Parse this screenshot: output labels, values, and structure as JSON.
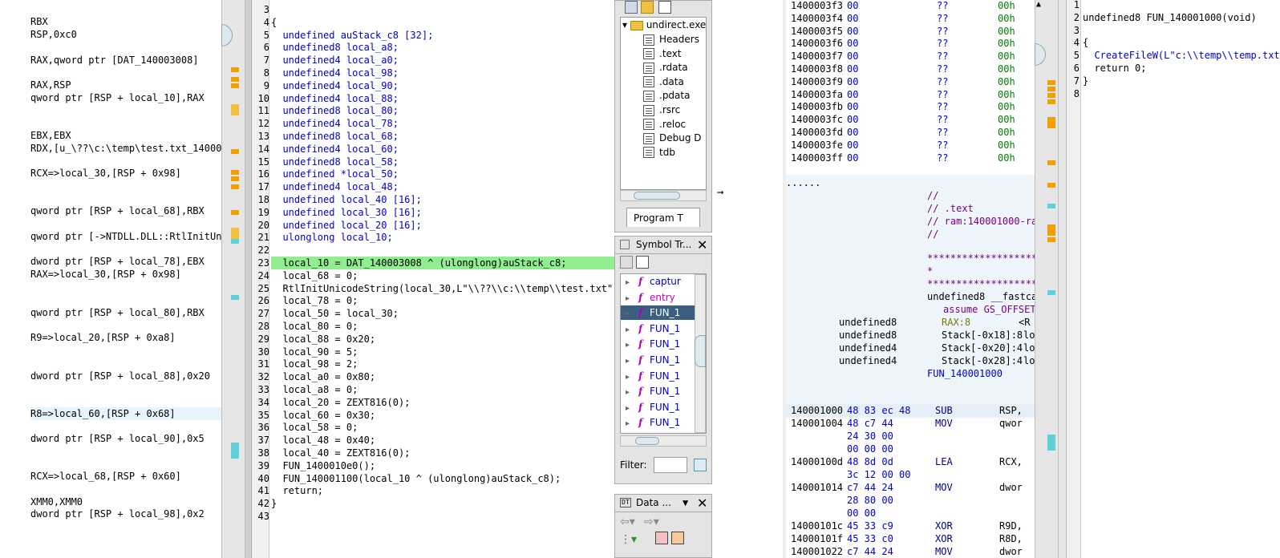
{
  "listing_left": {
    "lines": [
      {
        "t": "RBX",
        "c": ""
      },
      {
        "t": "RSP,0xc0",
        "c": ""
      },
      {
        "t": "",
        "c": ""
      },
      {
        "t": "RAX,qword ptr [DAT_140003008]",
        "c": ""
      },
      {
        "t": "",
        "c": ""
      },
      {
        "t": "RAX,RSP",
        "c": ""
      },
      {
        "t": "qword ptr [RSP + local_10],RAX",
        "c": ""
      },
      {
        "t": "",
        "c": ""
      },
      {
        "t": "",
        "c": ""
      },
      {
        "t": "EBX,EBX",
        "c": ""
      },
      {
        "t": "RDX,[u_\\??\\c:\\temp\\test.txt_140002",
        "c": ""
      },
      {
        "t": "",
        "c": ""
      },
      {
        "t": "RCX=>local_30,[RSP + 0x98]",
        "c": ""
      },
      {
        "t": "",
        "c": ""
      },
      {
        "t": "",
        "c": ""
      },
      {
        "t": "qword ptr [RSP + local_68],RBX",
        "c": ""
      },
      {
        "t": "",
        "c": ""
      },
      {
        "t": "qword ptr [->NTDLL.DLL::RtlInitUni",
        "c": ""
      },
      {
        "t": "",
        "c": ""
      },
      {
        "t": "dword ptr [RSP + local_78],EBX",
        "c": ""
      },
      {
        "t": "RAX=>local_30,[RSP + 0x98]",
        "c": ""
      },
      {
        "t": "",
        "c": ""
      },
      {
        "t": "",
        "c": ""
      },
      {
        "t": "qword ptr [RSP + local_80],RBX",
        "c": ""
      },
      {
        "t": "",
        "c": ""
      },
      {
        "t": "R9=>local_20,[RSP + 0xa8]",
        "c": ""
      },
      {
        "t": "",
        "c": ""
      },
      {
        "t": "",
        "c": ""
      },
      {
        "t": "dword ptr [RSP + local_88],0x20",
        "c": ""
      },
      {
        "t": "",
        "c": ""
      },
      {
        "t": "",
        "c": ""
      },
      {
        "t": "R8=>local_60,[RSP + 0x68]",
        "c": "sel"
      },
      {
        "t": "",
        "c": ""
      },
      {
        "t": "dword ptr [RSP + local_90],0x5",
        "c": ""
      },
      {
        "t": "",
        "c": ""
      },
      {
        "t": "",
        "c": ""
      },
      {
        "t": "RCX=>local_68,[RSP + 0x60]",
        "c": ""
      },
      {
        "t": "",
        "c": ""
      },
      {
        "t": "XMM0,XMM0",
        "c": ""
      },
      {
        "t": "dword ptr [RSP + local_98],0x2",
        "c": ""
      }
    ]
  },
  "decompile_main": {
    "lines": [
      {
        "n": "3",
        "t": ""
      },
      {
        "n": "4",
        "t": "{"
      },
      {
        "n": "5",
        "t": "  undefined auStack_c8 [32];"
      },
      {
        "n": "6",
        "t": "  undefined8 local_a8;"
      },
      {
        "n": "7",
        "t": "  undefined4 local_a0;"
      },
      {
        "n": "8",
        "t": "  undefined4 local_98;"
      },
      {
        "n": "9",
        "t": "  undefined4 local_90;"
      },
      {
        "n": "10",
        "t": "  undefined4 local_88;"
      },
      {
        "n": "11",
        "t": "  undefined8 local_80;"
      },
      {
        "n": "12",
        "t": "  undefined4 local_78;"
      },
      {
        "n": "13",
        "t": "  undefined8 local_68;"
      },
      {
        "n": "14",
        "t": "  undefined4 local_60;"
      },
      {
        "n": "15",
        "t": "  undefined8 local_58;"
      },
      {
        "n": "16",
        "t": "  undefined *local_50;"
      },
      {
        "n": "17",
        "t": "  undefined4 local_48;"
      },
      {
        "n": "18",
        "t": "  undefined local_40 [16];"
      },
      {
        "n": "19",
        "t": "  undefined local_30 [16];"
      },
      {
        "n": "20",
        "t": "  undefined local_20 [16];"
      },
      {
        "n": "21",
        "t": "  ulonglong local_10;"
      },
      {
        "n": "22",
        "t": ""
      },
      {
        "n": "23",
        "t": "  local_10 = DAT_140003008 ^ (ulonglong)auStack_c8;"
      },
      {
        "n": "24",
        "t": "  local_68 = 0;"
      },
      {
        "n": "25",
        "t": "  RtlInitUnicodeString(local_30,L\"\\\\??\\\\c:\\\\temp\\\\test.txt\");"
      },
      {
        "n": "26",
        "t": "  local_78 = 0;"
      },
      {
        "n": "27",
        "t": "  local_50 = local_30;"
      },
      {
        "n": "28",
        "t": "  local_80 = 0;"
      },
      {
        "n": "29",
        "t": "  local_88 = 0x20;"
      },
      {
        "n": "30",
        "t": "  local_90 = 5;"
      },
      {
        "n": "31",
        "t": "  local_98 = 2;"
      },
      {
        "n": "32",
        "t": "  local_a0 = 0x80;"
      },
      {
        "n": "33",
        "t": "  local_a8 = 0;"
      },
      {
        "n": "34",
        "t": "  local_20 = ZEXT816(0);"
      },
      {
        "n": "35",
        "t": "  local_60 = 0x30;"
      },
      {
        "n": "36",
        "t": "  local_58 = 0;"
      },
      {
        "n": "37",
        "t": "  local_48 = 0x40;"
      },
      {
        "n": "38",
        "t": "  local_40 = ZEXT816(0);"
      },
      {
        "n": "39",
        "t": "  FUN_1400010e0();"
      },
      {
        "n": "40",
        "t": "  FUN_140001100(local_10 ^ (ulonglong)auStack_c8);"
      },
      {
        "n": "41",
        "t": "  return;"
      },
      {
        "n": "42",
        "t": "}"
      },
      {
        "n": "43",
        "t": ""
      }
    ]
  },
  "program_tree": {
    "root": "undirect.exe",
    "items": [
      "Headers",
      ".text",
      ".rdata",
      ".data",
      ".pdata",
      ".rsrc",
      ".reloc",
      "Debug D",
      "tdb"
    ],
    "tab": "Program T"
  },
  "symbol_tree": {
    "title": "Symbol Tr...",
    "items": [
      "captur",
      "entry",
      "FUN_1",
      "FUN_1",
      "FUN_1",
      "FUN_1",
      "FUN_1",
      "FUN_1",
      "FUN_1",
      "FUN_1"
    ],
    "filter_label": "Filter:"
  },
  "data_panel": {
    "title": "Data ..."
  },
  "hex_listing": {
    "rows": [
      {
        "a": "1400003f3",
        "b": "00",
        "c": "??",
        "d": "00h"
      },
      {
        "a": "1400003f4",
        "b": "00",
        "c": "??",
        "d": "00h"
      },
      {
        "a": "1400003f5",
        "b": "00",
        "c": "??",
        "d": "00h"
      },
      {
        "a": "1400003f6",
        "b": "00",
        "c": "??",
        "d": "00h"
      },
      {
        "a": "1400003f7",
        "b": "00",
        "c": "??",
        "d": "00h"
      },
      {
        "a": "1400003f8",
        "b": "00",
        "c": "??",
        "d": "00h"
      },
      {
        "a": "1400003f9",
        "b": "00",
        "c": "??",
        "d": "00h"
      },
      {
        "a": "1400003fa",
        "b": "00",
        "c": "??",
        "d": "00h"
      },
      {
        "a": "1400003fb",
        "b": "00",
        "c": "??",
        "d": "00h"
      },
      {
        "a": "1400003fc",
        "b": "00",
        "c": "??",
        "d": "00h"
      },
      {
        "a": "1400003fd",
        "b": "00",
        "c": "??",
        "d": "00h"
      },
      {
        "a": "1400003fe",
        "b": "00",
        "c": "??",
        "d": "00h"
      },
      {
        "a": "1400003ff",
        "b": "00",
        "c": "??",
        "d": "00h"
      }
    ],
    "dots": "......",
    "comments": [
      "//",
      "// .text",
      "// ram:140001000-ram",
      "//"
    ],
    "stars": [
      "*****************************",
      "*",
      "*****************************"
    ],
    "sig": "undefined8 __fastcal",
    "assume": "assume GS_OFFSET",
    "params": [
      {
        "type": "undefined8",
        "loc": "RAX:8",
        "extra": "<R"
      },
      {
        "type": "undefined8",
        "loc": "Stack[-0x18]:8",
        "extra": "lo"
      },
      {
        "type": "undefined4",
        "loc": "Stack[-0x20]:4",
        "extra": "lo"
      },
      {
        "type": "undefined4",
        "loc": "Stack[-0x28]:4",
        "extra": "lo"
      }
    ],
    "label": "FUN_140001000",
    "instr": [
      {
        "a": "140001000",
        "b": "48 83 ec 48",
        "m": "SUB",
        "o": "RSP,"
      },
      {
        "a": "140001004",
        "b": "48 c7 44",
        "m": "MOV",
        "o": "qwor"
      },
      {
        "a": "",
        "b": "24 30 00",
        "m": "",
        "o": ""
      },
      {
        "a": "",
        "b": "00 00 00",
        "m": "",
        "o": ""
      },
      {
        "a": "14000100d",
        "b": "48 8d 0d",
        "m": "LEA",
        "o": "RCX,"
      },
      {
        "a": "",
        "b": "3c 12 00 00",
        "m": "",
        "o": ""
      },
      {
        "a": "140001014",
        "b": "c7 44 24",
        "m": "MOV",
        "o": "dwor"
      },
      {
        "a": "",
        "b": "28 80 00",
        "m": "",
        "o": ""
      },
      {
        "a": "",
        "b": "00 00",
        "m": "",
        "o": ""
      },
      {
        "a": "14000101c",
        "b": "45 33 c9",
        "m": "XOR",
        "o": "R9D,"
      },
      {
        "a": "14000101f",
        "b": "45 33 c0",
        "m": "XOR",
        "o": "R8D,"
      },
      {
        "a": "140001022",
        "b": "c7 44 24",
        "m": "MOV",
        "o": "dwor"
      }
    ]
  },
  "decompile_right": {
    "lines": [
      {
        "n": "1",
        "t": ""
      },
      {
        "n": "2",
        "t": "undefined8 FUN_140001000(void)"
      },
      {
        "n": "3",
        "t": ""
      },
      {
        "n": "4",
        "t": "{"
      },
      {
        "n": "5",
        "t": "  CreateFileW(L\"c:\\\\temp\\\\temp.txt\""
      },
      {
        "n": "6",
        "t": "  return 0;"
      },
      {
        "n": "7",
        "t": "}"
      },
      {
        "n": "8",
        "t": ""
      }
    ]
  }
}
